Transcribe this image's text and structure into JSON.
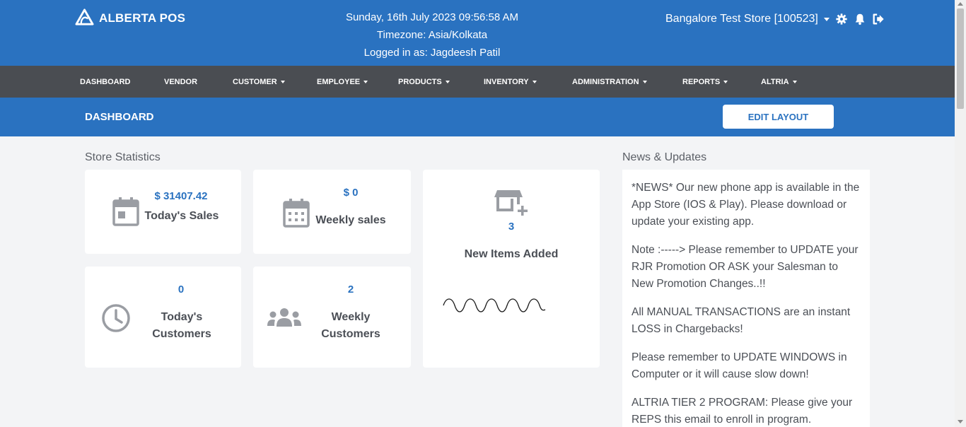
{
  "header": {
    "brand": "ALBERTA POS",
    "datetime": "Sunday, 16th July 2023 09:56:58 AM",
    "timezone": "Timezone: Asia/Kolkata",
    "logged_in": "Logged in as: Jagdeesh Patil",
    "store": "Bangalore Test Store [100523]",
    "icons": [
      "settings-gear-icon",
      "bell-icon",
      "logout-icon"
    ]
  },
  "nav": [
    {
      "label": "DASHBOARD",
      "dropdown": false
    },
    {
      "label": "VENDOR",
      "dropdown": false
    },
    {
      "label": "CUSTOMER",
      "dropdown": true
    },
    {
      "label": "EMPLOYEE",
      "dropdown": true
    },
    {
      "label": "PRODUCTS",
      "dropdown": true
    },
    {
      "label": "INVENTORY",
      "dropdown": true
    },
    {
      "label": "ADMINISTRATION",
      "dropdown": true
    },
    {
      "label": "REPORTS",
      "dropdown": true
    },
    {
      "label": "ALTRIA",
      "dropdown": true
    }
  ],
  "subheader": {
    "title": "DASHBOARD",
    "edit_button": "EDIT LAYOUT"
  },
  "stats": {
    "section_title": "Store Statistics",
    "todays_sales": {
      "value": "$ 31407.42",
      "label": "Today's Sales"
    },
    "weekly_sales": {
      "value": "$ 0",
      "label": "Weekly sales"
    },
    "new_items": {
      "value": "3",
      "label": "New Items Added"
    },
    "todays_customers": {
      "value": "0",
      "label_line1": "Today's",
      "label_line2": "Customers"
    },
    "weekly_customers": {
      "value": "2",
      "label_line1": "Weekly",
      "label_line2": "Customers"
    }
  },
  "news": {
    "title": "News & Updates",
    "items": [
      "*NEWS* Our new phone app is available in the App Store (IOS & Play). Please download or update your existing app.",
      "Note :-----> Please remember to UPDATE your RJR Promotion OR ASK your Salesman to New Promotion Changes..!!",
      "All MANUAL TRANSACTIONS are an instant LOSS in Chargebacks!",
      "Please remember to UPDATE WINDOWS in Computer or it will cause slow down!",
      "ALTRIA TIER 2 PROGRAM: Please give your REPS this email to enroll in program."
    ]
  },
  "colors": {
    "brand_blue": "#2a72c0",
    "nav_dark": "#4a4d52",
    "page_bg": "#f3f4f6",
    "icon_gray": "#9a9da3"
  }
}
